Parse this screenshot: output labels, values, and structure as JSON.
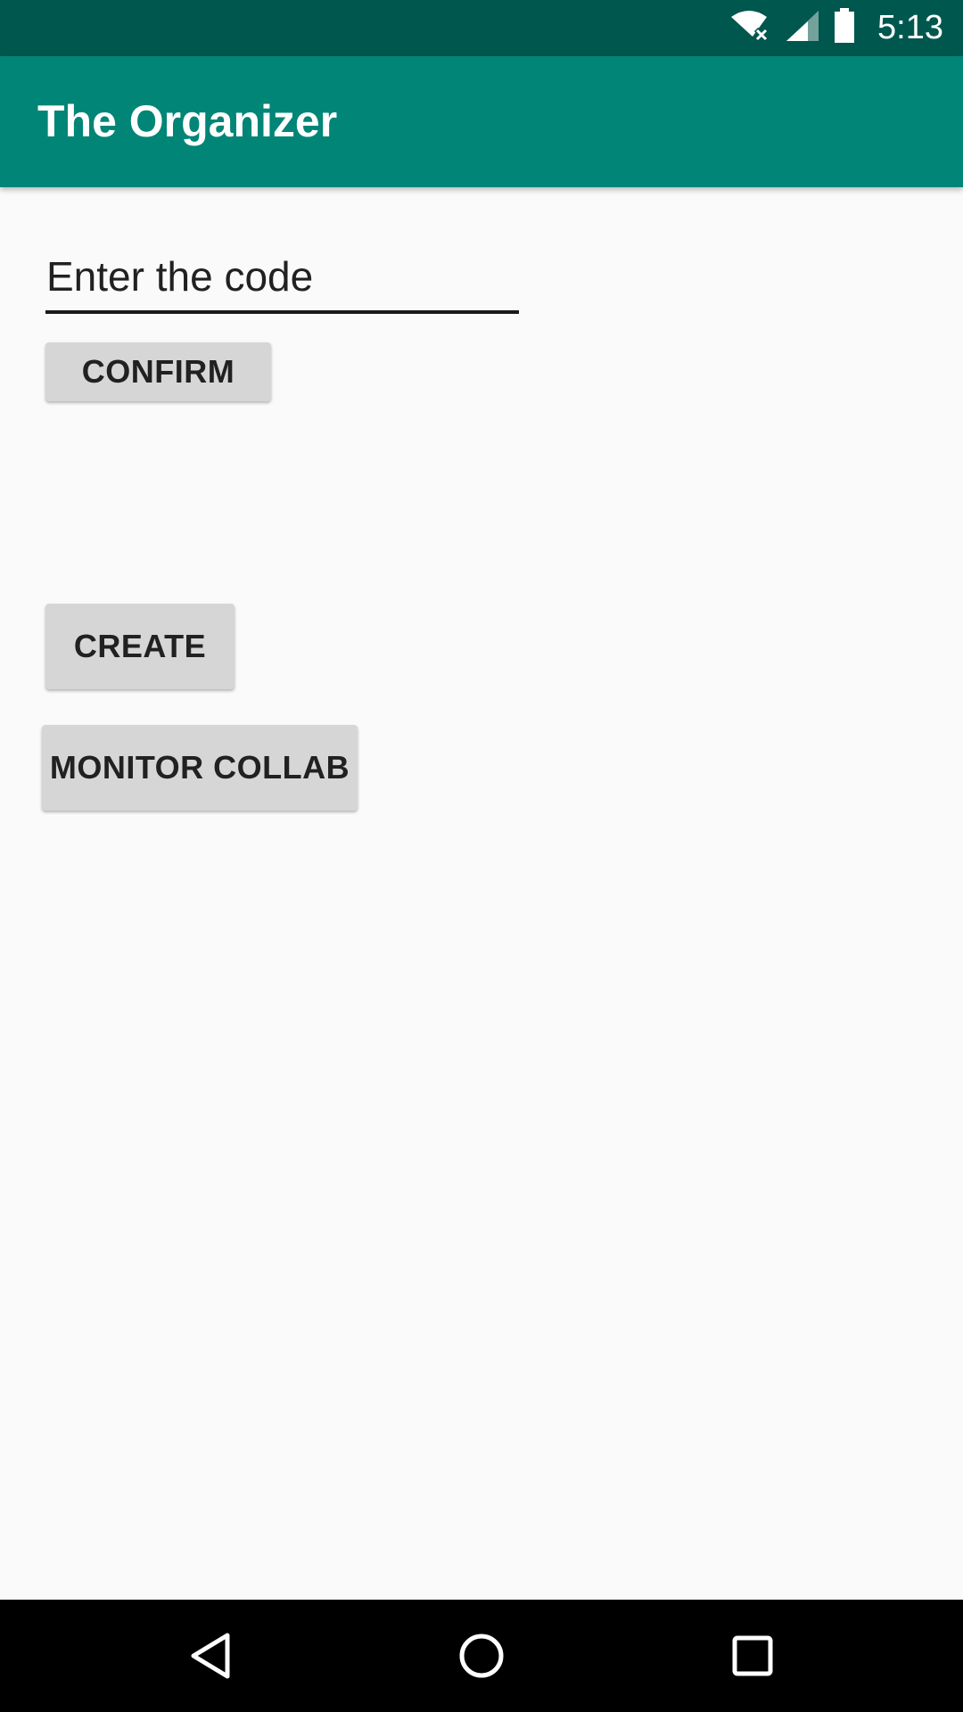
{
  "status_bar": {
    "time": "5:13",
    "icons": [
      "wifi-no-internet-icon",
      "cell-signal-icon",
      "battery-icon"
    ],
    "background": "#00574E"
  },
  "app_bar": {
    "title": "The Organizer",
    "background": "#008577"
  },
  "code_input": {
    "placeholder": "Enter the code",
    "value": ""
  },
  "buttons": {
    "confirm": "CONFIRM",
    "create": "CREATE",
    "monitor_collab": "MONITOR COLLAB"
  },
  "nav_bar": {
    "items": [
      "back-icon",
      "home-icon",
      "recents-icon"
    ]
  }
}
